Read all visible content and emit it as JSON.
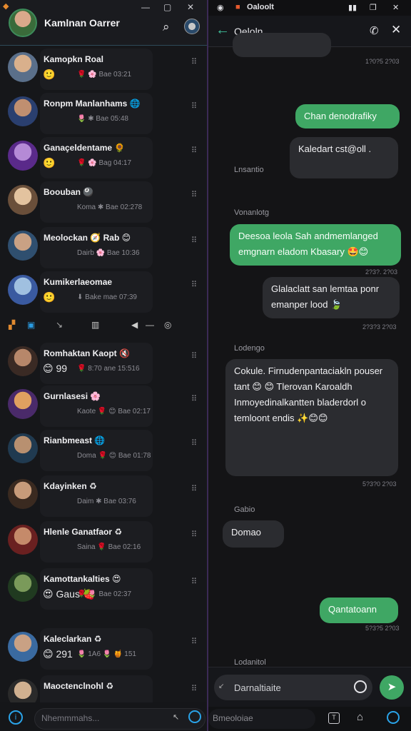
{
  "left": {
    "header": {
      "title": "Kamlnan Oarrer",
      "search_icon": "search-icon",
      "corner_icon": "app-icon"
    },
    "chats": [
      {
        "name": "Kamopkn Roal",
        "emoji": "🙂",
        "meta": "🌹 🌸 Bae 03:21",
        "avatar_colors": [
          "#d9b08c",
          "#5a6f8a"
        ]
      },
      {
        "name": "Ronpm Manlanhams 🌐",
        "emoji": "",
        "meta": "🌷 ✱ Bae 05:48",
        "avatar_colors": [
          "#c08f70",
          "#2a3f6f"
        ]
      },
      {
        "name": "Ganaçeldentame 🌻",
        "emoji": "🙂",
        "meta": "🌹 🌸 Bag 04:17",
        "avatar_colors": [
          "#b58ad6",
          "#5a2a8a"
        ]
      },
      {
        "name": "Boouban 🎱",
        "emoji": "",
        "meta": "Koma ✱ Bae 02:278",
        "avatar_colors": [
          "#e3c39f",
          "#6a4f3a"
        ]
      },
      {
        "name": "Meolockan 🧭 Rab 😊",
        "emoji": "",
        "meta": "Dairb 🌸 Bae 10:36",
        "avatar_colors": [
          "#c9a184",
          "#2f4f6f"
        ]
      },
      {
        "name": "Kumikerlaeomae",
        "emoji": "🙂",
        "meta": "⬇ Bake mae 07:39",
        "avatar_colors": [
          "#a0c0e0",
          "#3a5aa0"
        ]
      },
      {
        "name": "Romhaktan Kaopt 🔇",
        "emoji": "😊 99",
        "meta": "🌹 8:70 ane 15:516",
        "avatar_colors": [
          "#b7876a",
          "#3a2a24"
        ]
      },
      {
        "name": "Gurnlasesi 🌸",
        "emoji": "",
        "meta": "Kaote 🌹 😊 Bae 02:17",
        "avatar_colors": [
          "#e0a060",
          "#4a2a6a"
        ]
      },
      {
        "name": "Rianbmeast 🌐",
        "emoji": "",
        "meta": "Doma 🌹 😊 Bae 01:78",
        "avatar_colors": [
          "#b89070",
          "#203a50"
        ]
      },
      {
        "name": "Kdayinken ♻",
        "emoji": "",
        "meta": "Daim ✱ Bae 03:76",
        "avatar_colors": [
          "#c79b7a",
          "#3a2a20"
        ]
      },
      {
        "name": "Hlenle Ganatfaor ♻",
        "emoji": "",
        "meta": "Saina 🌹 Bae 02:16",
        "avatar_colors": [
          "#c58a6a",
          "#6a2020"
        ]
      },
      {
        "name": "Kamottankalties 😍",
        "emoji": "😍 Gaus 🍓",
        "meta": "🌹 🌷 Bae 02:37",
        "avatar_colors": [
          "#7a9a5a",
          "#203a20"
        ]
      },
      {
        "name": "Kaleclarkan ♻",
        "emoji": "😊 291",
        "meta": "🌷 1A6 🌷 🍯 151",
        "avatar_colors": [
          "#c9a184",
          "#3a6aa0"
        ]
      },
      {
        "name": "Maoctenclnohl ♻",
        "emoji": "",
        "meta": "",
        "avatar_colors": [
          "#d0b090",
          "#2a2a2a"
        ]
      }
    ],
    "toolbar_icons": [
      "cube-icon",
      "square-icon",
      "cursor-icon",
      "bookmark-icon",
      "arrow-left-icon",
      "minus-icon",
      "target-icon"
    ],
    "bottom": {
      "placeholder": "Nhemmmahs..."
    }
  },
  "right": {
    "status": {
      "app_icon": "camera-icon",
      "app_title": "Oaloolt",
      "signal": "signal-icon"
    },
    "header": {
      "contact_name": "Oeloln"
    },
    "messages": [
      {
        "kind": "out",
        "text": "Chan denodrafiky",
        "time": ""
      },
      {
        "kind": "in",
        "text": "Kaledart cst@oll .",
        "time": ""
      },
      {
        "kind": "label",
        "text": "Lnsantio"
      },
      {
        "kind": "label",
        "text": "Vonanlotg"
      },
      {
        "kind": "out",
        "text": "Deesoa leola Sah andmemlanged emgnarn eladom Kbasary 🤩😊",
        "time": "2?3?. 2?03"
      },
      {
        "kind": "in",
        "text": "Glalaclatt san lemtaa ponr emanper lood 🍃",
        "time": "2?3?3 2?03"
      },
      {
        "kind": "label",
        "text": "Lodengo"
      },
      {
        "kind": "in",
        "text": "Cokule. Firnudenpantaciakln pouser tant 😊 😊 Tlerovan Karoaldh Inmoyedinalkantten bladerdorl o temloont endis ✨😊😊",
        "time": "5?3?0 2?03"
      },
      {
        "kind": "label",
        "text": "Gabio"
      },
      {
        "kind": "in",
        "text": "Domao",
        "time": ""
      },
      {
        "kind": "out",
        "text": "Qantatoann",
        "time": "5?3?5 2?03"
      },
      {
        "kind": "label",
        "text": "Lodanitol"
      }
    ],
    "top_partial_time": "1?0?5 2?03",
    "composer": {
      "value": "Darnaltiaite"
    },
    "bottom": {
      "placeholder": "Bmeoloiae"
    }
  },
  "colors": {
    "accent_green": "#3fa764",
    "accent_blue": "#2aa3e8",
    "divider": "#3b2a55"
  }
}
